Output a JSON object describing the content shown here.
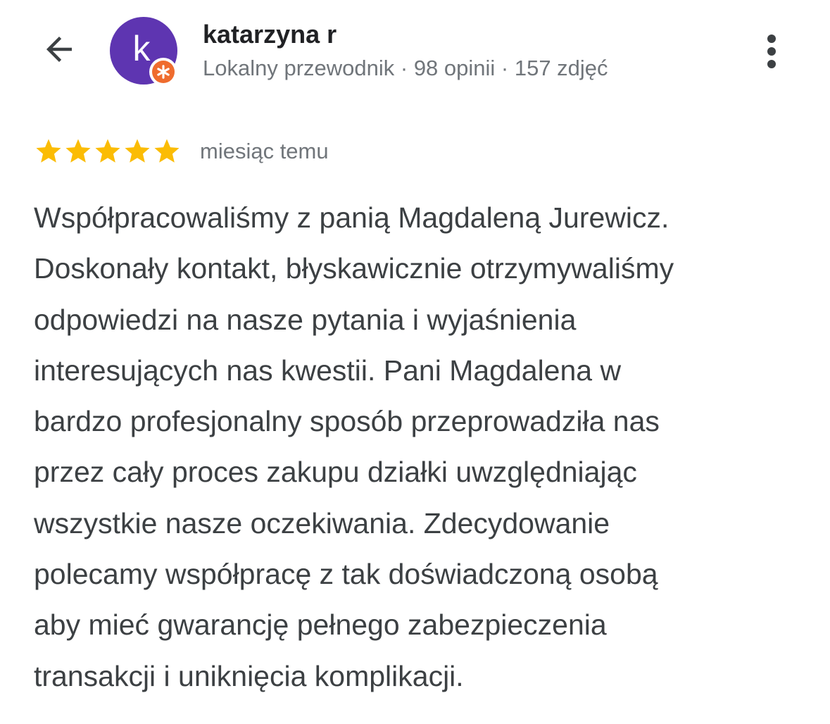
{
  "header": {
    "back_icon": "arrow-left-icon",
    "more_icon": "more-vert-icon",
    "user": {
      "avatar_letter": "k",
      "avatar_color": "#5e35b1",
      "badge_icon": "local-guide-star-icon",
      "badge_color": "#ef6c2e",
      "name": "katarzyna r",
      "meta": "Lokalny przewodnik · 98 opinii · 157 zdjęć"
    }
  },
  "review": {
    "rating": 5,
    "rating_max": 5,
    "star_color": "#fbbc04",
    "star_icon": "star-icon",
    "date": "miesiąc temu",
    "text_lines": [
      "Współpracowaliśmy z panią Magdaleną Jurewicz.",
      "Doskonały kontakt, błyskawicznie otrzymywaliśmy",
      "odpowiedzi na nasze pytania i wyjaśnienia",
      "interesujących nas kwestii. Pani Magdalena w",
      "bardzo profesjonalny sposób przeprowadziła nas",
      "przez cały proces zakupu działki uwzględniając",
      "wszystkie nasze oczekiwania. Zdecydowanie",
      "polecamy współpracę z tak doświadczoną osobą",
      "aby mieć gwarancję pełnego zabezpieczenia",
      "transakcji i uniknięcia komplikacji."
    ]
  }
}
